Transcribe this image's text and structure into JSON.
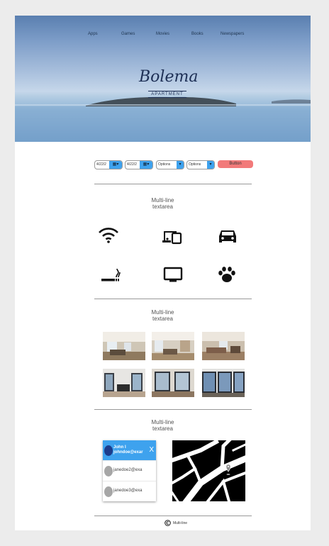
{
  "nav": {
    "items": [
      "Apps",
      "Games",
      "Movies",
      "Books",
      "Newspapers"
    ]
  },
  "logo": {
    "title": "Bolema",
    "subtitle": "APARTMENT"
  },
  "controls": {
    "date_from": "4/22/2",
    "date_to": "4/22/2",
    "select1": "Options",
    "select2": "Options",
    "button": "Button"
  },
  "sections": {
    "heading1": [
      "Multi-line",
      "textarea"
    ],
    "heading2": [
      "Multi-line",
      "textarea"
    ],
    "heading3": [
      "Multi-line",
      "textarea"
    ]
  },
  "amenities": [
    "wifi-icon",
    "devices-icon",
    "car-icon",
    "smoking-icon",
    "tv-icon",
    "pet-icon"
  ],
  "gallery": [
    "room-photo-1",
    "room-photo-2",
    "room-photo-3",
    "room-photo-4",
    "room-photo-5",
    "room-photo-6"
  ],
  "contacts": {
    "active": {
      "name": "John I",
      "email": "johndoe@exar",
      "close": "X"
    },
    "rows": [
      "janedoe2@exa",
      "janedoe3@exa"
    ]
  },
  "footer": {
    "text": "Multi-line"
  },
  "colors": {
    "accent": "#3ea2ee",
    "button": "#f27a7a",
    "divider": "#999999"
  }
}
